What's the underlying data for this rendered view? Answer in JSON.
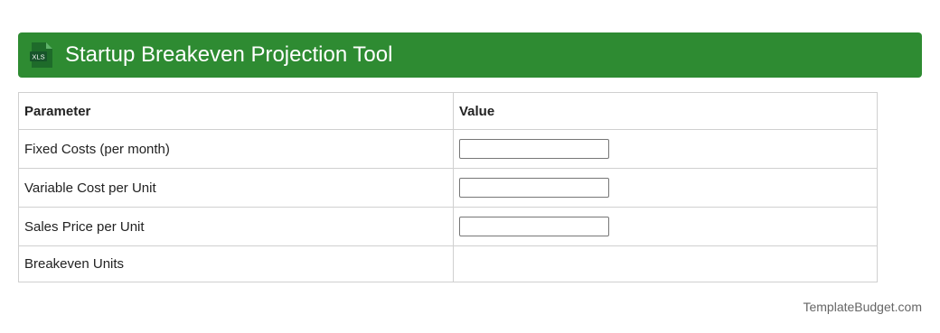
{
  "header": {
    "icon": "xls-file-icon",
    "icon_label": "XLS",
    "title": "Startup Breakeven Projection Tool",
    "background_color": "#2e8b32"
  },
  "table": {
    "columns": [
      "Parameter",
      "Value"
    ],
    "rows": [
      {
        "label": "Fixed Costs (per month)",
        "value": ""
      },
      {
        "label": "Variable Cost per Unit",
        "value": ""
      },
      {
        "label": "Sales Price per Unit",
        "value": ""
      },
      {
        "label": "Breakeven Units",
        "value": ""
      }
    ]
  },
  "footer": {
    "credit": "TemplateBudget.com"
  }
}
